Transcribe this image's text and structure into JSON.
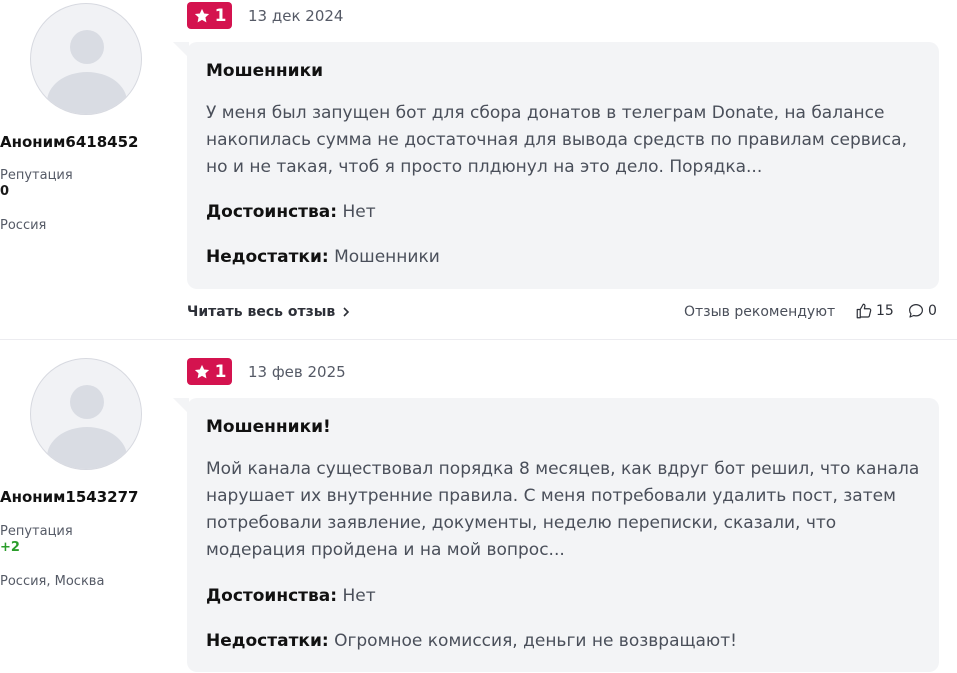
{
  "reviews": [
    {
      "author": "Аноним6418452",
      "reputation_label": "Репутация",
      "reputation_value": "0",
      "reputation_color": "#1a1a1a",
      "location": "Россия",
      "rating": "1",
      "date": "13 дек 2024",
      "title": "Мошенники",
      "text": "У меня был запущен бот для сбора донатов в телеграм Donate, на балансе накопилась сумма не достаточная для вывода средств по правилам сервиса, но и не такая, чтоб я просто плдюнул на это дело. Порядка...",
      "pros_label": "Достоинства:",
      "pros": "Нет",
      "cons_label": "Недостатки:",
      "cons": "Мошенники",
      "read_more": "Читать весь отзыв",
      "recommend_label": "Отзыв рекомендуют",
      "likes": "15",
      "comments": "0"
    },
    {
      "author": "Аноним1543277",
      "reputation_label": "Репутация",
      "reputation_value": "+2",
      "reputation_color": "#2a9d2a",
      "location": "Россия, Москва",
      "rating": "1",
      "date": "13 фев 2025",
      "title": "Мошенники!",
      "text": "Мой канала существовал порядка 8 месяцев, как вдруг бот решил, что канала нарушает их внутренние правила. С меня потребовали удалить пост, затем потребовали заявление, документы, неделю переписки, сказали, что модерация пройдена и на мой вопрос...",
      "pros_label": "Достоинства:",
      "pros": "Нет",
      "cons_label": "Недостатки:",
      "cons": "Огромное комиссия, деньги не возвращают!"
    }
  ],
  "colors": {
    "rating_badge": "#d4134f",
    "card_background": "#f3f4f6"
  },
  "icons": [
    "star-icon",
    "chevron-right-icon",
    "thumbs-up-icon",
    "comment-icon"
  ]
}
